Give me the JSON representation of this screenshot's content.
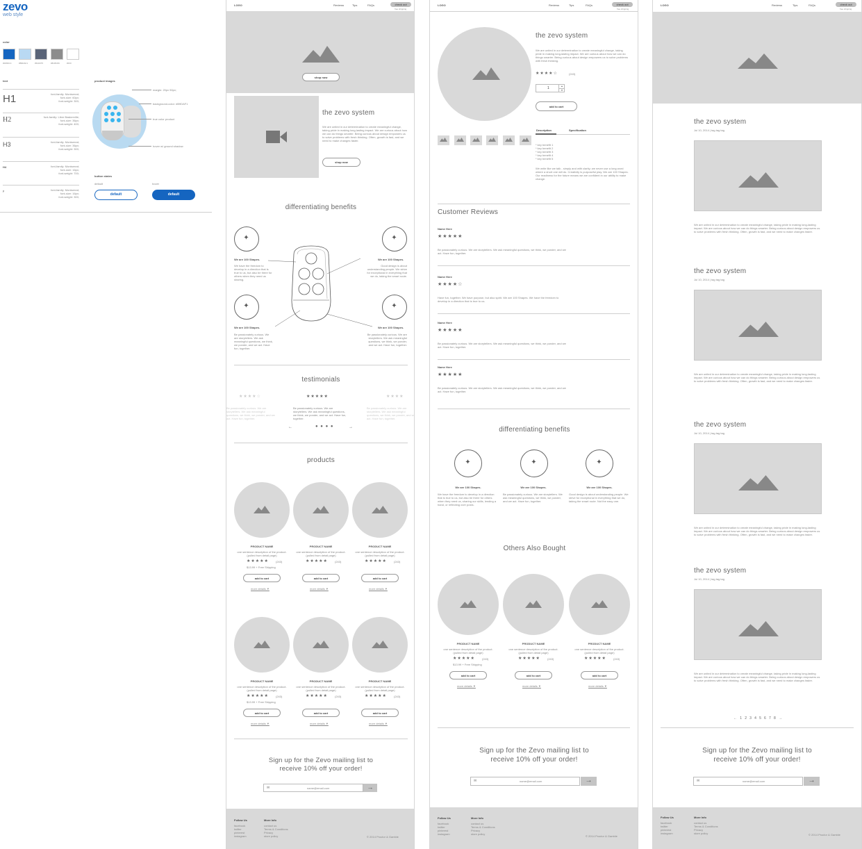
{
  "style": {
    "logo": "zevo",
    "subtitle": "web style",
    "color_label": "color",
    "colors": [
      {
        "hex": "#1565c0",
        "name": "#0066CC"
      },
      {
        "hex": "#b9d9f3",
        "name": "#B9DAF1"
      },
      {
        "hex": "#5a6478",
        "name": "#5A6375"
      },
      {
        "hex": "#8c8c8c",
        "name": "#8C8C8C"
      },
      {
        "hex": "#ffffff",
        "name": "#FFF"
      }
    ],
    "text_label": "text",
    "h1": "H1",
    "h2": "H2",
    "h3": "H3",
    "h4": "H4",
    "p": "p",
    "h1_spec": [
      "font-family: Montserrat;",
      "font-size: 60px;",
      "font-weight: 300;"
    ],
    "h2_spec": [
      "font-family: Libre Baskerville;",
      "font-size: 36px;",
      "font-weight: 400;"
    ],
    "h3_spec": [
      "font-family: Montserrat;",
      "font-size: 36px;",
      "font-weight: 300;"
    ],
    "h4_spec": [
      "font-family: Montserrat;",
      "font-size: 16px;",
      "font-weight: 700;"
    ],
    "p_spec": [
      "font-family: Montserrat;",
      "font-size: 16px;",
      "font-weight: 300;"
    ],
    "product_images_label": "product images",
    "img_notes": [
      "margin: 20px 50px;",
      "background-color: #B9DAF1",
      "true color product",
      "hover w/ ground shadow"
    ],
    "button_states_label": "button states",
    "default_label": "default",
    "hover_label": "hover",
    "btn_default": "default",
    "btn_hover": "default"
  },
  "nav": {
    "logo": "LOGO",
    "links": [
      "Reviews",
      "Tips",
      "FAQs"
    ],
    "checkout": "check out",
    "sub": "free shipping"
  },
  "home": {
    "hero_button": "shop now",
    "system_title": "the zevo system",
    "system_body": "We are united in our determination to create meaningful change, taking pride in making long-lasting impact. We are curious about how we can do things smarter. Being curious about design empowers us to solve problems with fresh thinking. Often, growth is fast, and we need to make changes faster.",
    "system_button": "shop now",
    "benefits_title": "differentiating benefits",
    "benefit_head": "We are 100 Shapes.",
    "benefit_texts": [
      "We have the freedom to develop in a direction that is true to us, but also be there for others when they need us sharing.",
      "Good design is about understanding people. We strive for exceptional in everything that we do, taking the smart route.",
      "Be passionately curious. We are storytellers. We ask meaningful questions, we think, we ponder, and we act. Have fun, together.",
      "Be passionately curious. We are storytellers. We ask meaningful questions, we think, we ponder, and we act. Have fun, together."
    ],
    "testimonials_title": "testimonials",
    "testimonial_text": "Be passionately curious. We are storytellers. We ask meaningful questions, we think, we ponder, and we act. Have fun, together.",
    "products_title": "products",
    "product_name": "PRODUCT NAME",
    "product_desc": "one sentence description of the product. (pulled from detail page)",
    "rating_count": "(243)",
    "price": "$13.99 + Free Shipping",
    "add_to_cart": "add to cart",
    "more_details": "more details ▼",
    "signup": "Sign up for the Zevo mailing list to receive 10% off your order!",
    "email_placeholder": "name@email.com"
  },
  "detail": {
    "title": "the zevo system",
    "body": "We are united in our determination to create meaningful change, taking pride in making long-lasting impact. We are curious about how we can do things smarter. Being curious about design empowers us to solve problems with fresh thinking.",
    "rating_count": "(243)",
    "qty": "1",
    "add_to_cart": "add to cart",
    "tabs": [
      "Description",
      "Specification"
    ],
    "benefits_list": [
      "* key benefit 1",
      "* key benefit 2",
      "* key benefit 3",
      "* key benefit 4",
      "* key benefit 5"
    ],
    "desc": "We write like we talk - simply and with clarity; we never use a long word where a short one will do. Creativity is purposeful play. We are 100 Shapes. Our readiness for the future means we are confident in our ability to make change.",
    "reviews_title": "Customer Reviews",
    "reviewer": "Name Here",
    "reviews": [
      "Be passionately curious. We are storytellers. We ask meaningful questions, we think, we ponder, and we act. Have fun, together.",
      "Have fun, together. We have purpose, but also spirit. We are 100 Shapes. We have the freedom to develop in a direction that is true to us.",
      "Be passionately curious. We are storytellers. We ask meaningful questions, we think, we ponder, and we act. Have fun, together.",
      "Be passionately curious. We are storytellers. We ask meaningful questions, we think, we ponder, and we act. Have fun, together."
    ],
    "benefits_title": "differentiating benefits",
    "benefit_head": "We are 100 Shapes.",
    "benefit_texts": [
      "We have the freedom to develop in a direction that is true to us, but also be there for others when they need us, sharing our skills, lending a hand, or reflecting over posts.",
      "Be passionately curious. We are storytellers. We ask meaningful questions, we think, we ponder, and we act. Have fun, together.",
      "Good design is about understanding people. We strive for exceptional in everything that we do, taking the smart route. Not the easy one."
    ],
    "others_title": "Others Also Bought"
  },
  "blog": {
    "post_title": "the zevo system",
    "post_meta": "Jul 10, 2014 | tag tag tag",
    "post_body": "We are united in our determination to create meaningful change, taking pride in making long-lasting impact. We are curious about how we can do things smarter. Being curious about design empowers us to solve problems with fresh thinking. Often, growth is fast, and we need to make changes faster.",
    "pagination": [
      "1",
      "2",
      "3",
      "4",
      "5",
      "6",
      "7",
      "8"
    ]
  },
  "footer": {
    "follow": "Follow Us",
    "follow_links": [
      "facebook",
      "twitter",
      "pinterest",
      "instagram"
    ],
    "more": "More Info",
    "more_links": [
      "contact us",
      "Terms & Conditions",
      "Privacy",
      "store policy"
    ],
    "copyright": "© 2014 Proctor & Gamble"
  }
}
